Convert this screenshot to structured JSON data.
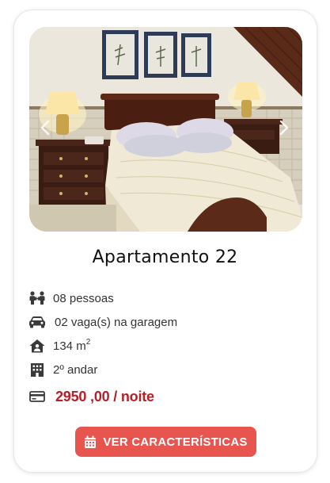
{
  "card": {
    "title": "Apartamento 22",
    "features": {
      "capacity": {
        "icon": "people-icon",
        "text": "08 pessoas"
      },
      "parking": {
        "icon": "car-icon",
        "text": "02 vaga(s) na garagem"
      },
      "area": {
        "icon": "house-user-icon",
        "text": "134 m",
        "sup": "2"
      },
      "floor": {
        "icon": "building-icon",
        "text": "2º andar"
      },
      "price": {
        "icon": "credit-card-icon",
        "text": "2950 ,00 / noite"
      }
    },
    "button": {
      "icon": "calendar-icon",
      "label": "VER CARACTERÍSTICAS"
    }
  },
  "colors": {
    "accent_button": "#e8544e",
    "price_text": "#b51f28",
    "icon": "#3a3a3a"
  }
}
